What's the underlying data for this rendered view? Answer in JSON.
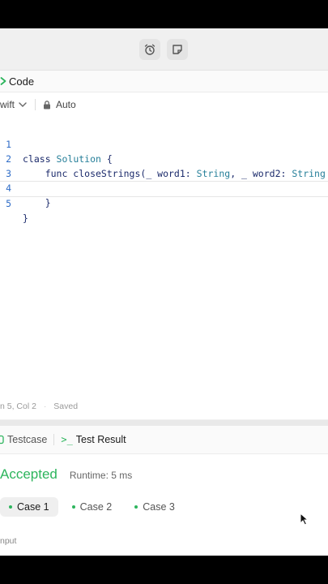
{
  "toolbar": {
    "alarm_icon": "alarm-clock-icon",
    "note_icon": "note-icon"
  },
  "code_panel": {
    "title": "Code",
    "language": "wift",
    "mode": "Auto",
    "lines": [
      {
        "num": "1",
        "text": "class Solution {"
      },
      {
        "num": "2",
        "text": "    func closeStrings(_ word1: String, _ word2: String"
      },
      {
        "num": "3",
        "text": ""
      },
      {
        "num": "4",
        "text": "    }"
      },
      {
        "num": "5",
        "text": "}"
      }
    ],
    "status_position": "n 5, Col 2",
    "status_saved": "Saved"
  },
  "bottom_panel": {
    "tab_testcase": "Testcase",
    "tab_result_icon": ">_",
    "tab_result": "Test Result",
    "verdict": "Accepted",
    "runtime": "Runtime: 5 ms",
    "cases": [
      "Case 1",
      "Case 2",
      "Case 3"
    ],
    "input_label": "nput"
  },
  "colors": {
    "accent_green": "#2db55d",
    "code_keyword": "#1b2a6b",
    "line_number": "#2e6cc7"
  }
}
